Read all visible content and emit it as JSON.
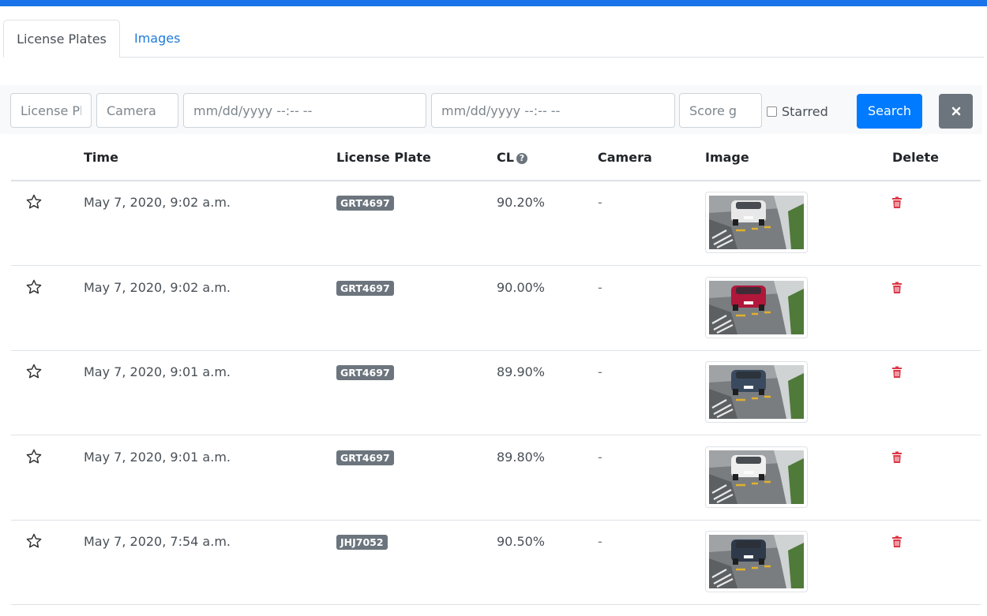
{
  "tabs": [
    {
      "label": "License Plates",
      "active": true
    },
    {
      "label": "Images",
      "active": false
    }
  ],
  "filters": {
    "license_plate_placeholder": "License Pl",
    "camera_placeholder": "Camera",
    "start_datetime": "mm/dd/yyyy --:-- --",
    "end_datetime": "mm/dd/yyyy --:-- --",
    "score_placeholder": "Score g",
    "starred_label": "Starred",
    "search_label": "Search",
    "clear_icon": "times-icon"
  },
  "table": {
    "columns": [
      "Time",
      "License Plate",
      "CL",
      "Camera",
      "Image",
      "Delete"
    ],
    "rows": [
      {
        "time": "May 7, 2020, 9:02 a.m.",
        "plate": "GRT4697",
        "cl": "90.20%",
        "camera": "-",
        "car_color": "#e8e8e8"
      },
      {
        "time": "May 7, 2020, 9:02 a.m.",
        "plate": "GRT4697",
        "cl": "90.00%",
        "camera": "-",
        "car_color": "#b0173a"
      },
      {
        "time": "May 7, 2020, 9:01 a.m.",
        "plate": "GRT4697",
        "cl": "89.90%",
        "camera": "-",
        "car_color": "#3a4a5e"
      },
      {
        "time": "May 7, 2020, 9:01 a.m.",
        "plate": "GRT4697",
        "cl": "89.80%",
        "camera": "-",
        "car_color": "#efefef"
      },
      {
        "time": "May 7, 2020, 7:54 a.m.",
        "plate": "JHJ7052",
        "cl": "90.50%",
        "camera": "-",
        "car_color": "#2e3a4a"
      }
    ]
  },
  "colors": {
    "accent": "#007bff",
    "top_bar": "#1a73e8",
    "delete": "#dc3545",
    "badge": "#6c757d"
  }
}
